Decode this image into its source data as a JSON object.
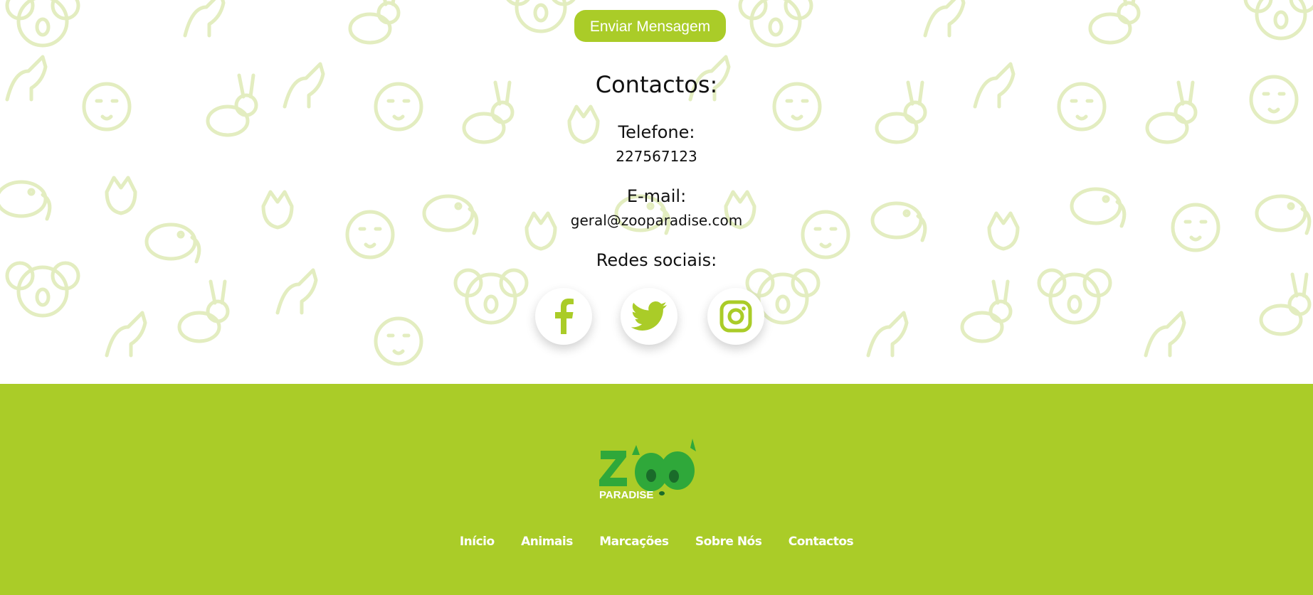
{
  "contact_form": {
    "send_button_label": "Enviar Mensagem"
  },
  "contacts": {
    "title": "Contactos:",
    "phone_label": "Telefone:",
    "phone_value": "227567123",
    "email_label": "E-mail:",
    "email_value": "geral@zooparadise.com",
    "social_label": "Redes sociais:",
    "social_links": [
      {
        "name": "facebook-icon"
      },
      {
        "name": "twitter-icon"
      },
      {
        "name": "instagram-icon"
      }
    ]
  },
  "footer": {
    "logo_text_main": "ZOO",
    "logo_text_sub": "PARADISE",
    "nav": [
      "Início",
      "Animais",
      "Marcações",
      "Sobre Nós",
      "Contactos"
    ]
  },
  "colors": {
    "accent": "#aacc28",
    "logo_green": "#2fa83a",
    "pattern": "#e6f0c5"
  }
}
